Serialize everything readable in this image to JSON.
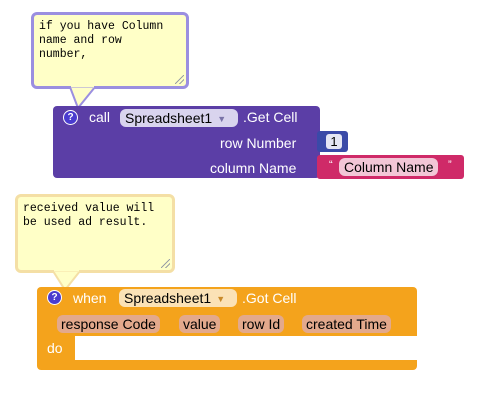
{
  "comments": [
    {
      "text": "if you have Column\nname and row\nnumber,"
    },
    {
      "text": "received value will\nbe used ad result."
    }
  ],
  "call_block": {
    "help_glyph": "?",
    "keyword": "call",
    "component": "Spreadsheet1",
    "method": ".Get Cell",
    "sockets": [
      {
        "label": "row Number",
        "value": "1"
      },
      {
        "label": "column Name",
        "value": "Column Name"
      }
    ],
    "quote_open": "“",
    "quote_close": "”"
  },
  "event_block": {
    "help_glyph": "?",
    "keyword": "when",
    "component": "Spreadsheet1",
    "event": ".Got Cell",
    "params": [
      "response Code",
      "value",
      "row Id",
      "created Time"
    ],
    "do_label": "do"
  },
  "colors": {
    "call_block": "#5b3ea6",
    "number_block": "#3a4aa8",
    "text_block": "#cf2a68",
    "event_block": "#f4a31c",
    "comment_bg": "#ffffc7"
  }
}
